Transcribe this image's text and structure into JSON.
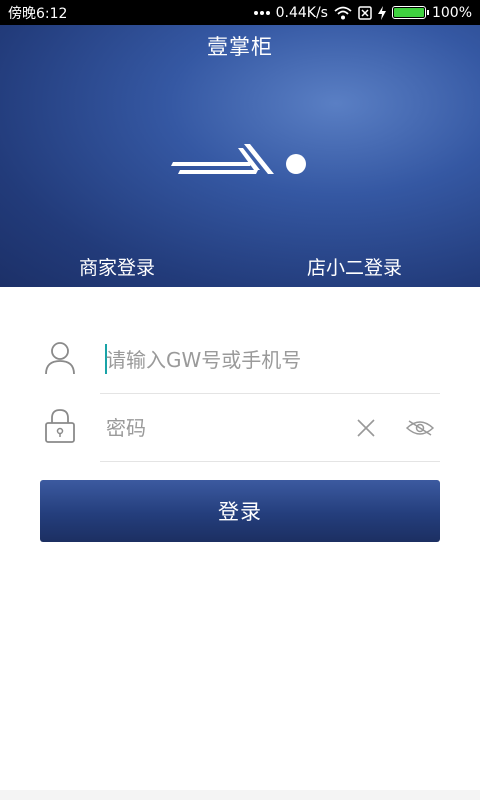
{
  "status_bar": {
    "time": "傍晚6:12",
    "speed": "0.44K/s",
    "battery_label": "100%",
    "battery_level": 1.0,
    "icons": [
      "more-dots-icon",
      "wifi-icon",
      "sim-card-icon",
      "charging-bolt-icon",
      "battery-icon"
    ]
  },
  "header": {
    "title": "壹掌柜",
    "logo_icon": "app-logo-icon",
    "tabs": [
      {
        "label": "商家登录"
      },
      {
        "label": "店小二登录"
      }
    ]
  },
  "form": {
    "username": {
      "placeholder": "请输入GW号或手机号",
      "value": "",
      "icon": "user-icon"
    },
    "password": {
      "placeholder": "密码",
      "value": "",
      "icon": "lock-icon",
      "clear_icon": "close-icon",
      "toggle_icon": "eye-hidden-icon"
    },
    "submit_label": "登录"
  },
  "colors": {
    "status_bg": "#000000",
    "header_gradient": [
      "#5a7fc4",
      "#223b7a"
    ],
    "button_bg": "#243e7c",
    "caret": "#19a3a7",
    "battery_fill": "#3fd13f"
  }
}
